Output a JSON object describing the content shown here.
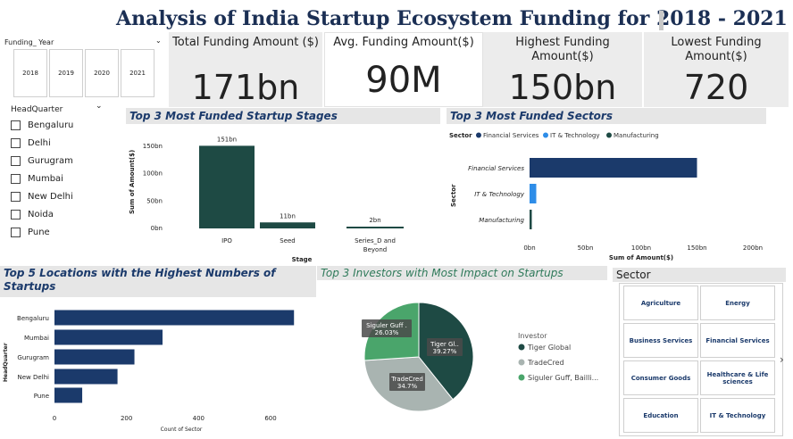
{
  "title": "Analysis of India Startup Ecosystem Funding for 2018 - 2021",
  "year_slicer": {
    "label": "Funding_ Year",
    "years": [
      "2018",
      "2019",
      "2020",
      "2021"
    ]
  },
  "hq_slicer": {
    "label": "HeadQuarter",
    "items": [
      "Bengaluru",
      "Delhi",
      "Gurugram",
      "Mumbai",
      "New Delhi",
      "Noida",
      "Pune"
    ]
  },
  "kpis": {
    "total": {
      "label": "Total Funding Amount ($)",
      "value": "171bn"
    },
    "avg": {
      "label": "Avg. Funding Amount($)",
      "value": "90M"
    },
    "highest": {
      "label": "Highest Funding Amount($)",
      "value": "150bn"
    },
    "lowest": {
      "label": "Lowest Funding Amount($)",
      "value": "720"
    }
  },
  "stages_chart": {
    "header": "Top 3 Most Funded Startup Stages",
    "ylabel": "Sum of Amount($)",
    "xlabel": "Stage",
    "yticks": [
      "150bn",
      "100bn",
      "50bn",
      "0bn"
    ],
    "bar_color": "#1e4a44"
  },
  "sectors_chart": {
    "header": "Top 3 Most Funded Sectors",
    "legend_title": "Sector",
    "ylabel": "Sector",
    "xlabel": "Sum of Amount($)",
    "xticks": [
      "0bn",
      "50bn",
      "100bn",
      "150bn",
      "200bn"
    ]
  },
  "locations_chart": {
    "header": "Top 5 Locations with the Highest Numbers of Startups",
    "ylabel": "HeadQuarter",
    "xlabel": "Count of Sector",
    "xticks": [
      "0",
      "200",
      "400",
      "600"
    ],
    "bar_color": "#1b3a6b"
  },
  "investors_chart": {
    "header": "Top 3 Investors with Most Impact on Startups",
    "legend_title": "Investor"
  },
  "sector_tiles": {
    "header": "Sector",
    "items": [
      "Agriculture",
      "Energy",
      "Business Services",
      "Financial Services",
      "Consumer Goods",
      "Healthcare & Life sciences",
      "Education",
      "IT & Technology"
    ]
  },
  "chart_data": [
    {
      "type": "bar",
      "title": "Top 3 Most Funded Startup Stages",
      "categories": [
        "IPO",
        "Seed",
        "Series_D and Beyond"
      ],
      "values": [
        151,
        11,
        2
      ],
      "data_labels": [
        "151bn",
        "11bn",
        "2bn"
      ],
      "xlabel": "Stage",
      "ylabel": "Sum of Amount($)",
      "ylim": [
        0,
        150
      ]
    },
    {
      "type": "bar",
      "orientation": "horizontal",
      "title": "Top 3 Most Funded Sectors",
      "categories": [
        "Financial Services",
        "IT & Technology",
        "Manufacturing"
      ],
      "values": [
        150,
        6,
        2
      ],
      "colors": [
        "#1b3a6b",
        "#2e8de8",
        "#1e4a44"
      ],
      "xlabel": "Sum of Amount($)",
      "ylabel": "Sector",
      "xlim": [
        0,
        200
      ],
      "legend": "top"
    },
    {
      "type": "bar",
      "orientation": "horizontal",
      "title": "Top 5 Locations with the Highest Numbers of Startups",
      "categories": [
        "Bengaluru",
        "Mumbai",
        "Gurugram",
        "New Delhi",
        "Pune"
      ],
      "values": [
        665,
        300,
        222,
        175,
        77
      ],
      "xlabel": "Count of Sector",
      "ylabel": "HeadQuarter",
      "xlim": [
        0,
        700
      ]
    },
    {
      "type": "pie",
      "title": "Top 3 Investors with Most Impact on Startups",
      "categories": [
        "Tiger Global",
        "TradeCred",
        "Siguler Guff, Bailli..."
      ],
      "slice_labels": [
        "Tiger Gl..",
        "TradeCred",
        "Siguler Guff ."
      ],
      "values": [
        39.27,
        34.7,
        26.03
      ],
      "value_labels": [
        "39.27%",
        "34.7%",
        "26.03%"
      ],
      "colors": [
        "#1e4a44",
        "#a9b4b1",
        "#4aa56b"
      ],
      "legend": "right"
    }
  ]
}
